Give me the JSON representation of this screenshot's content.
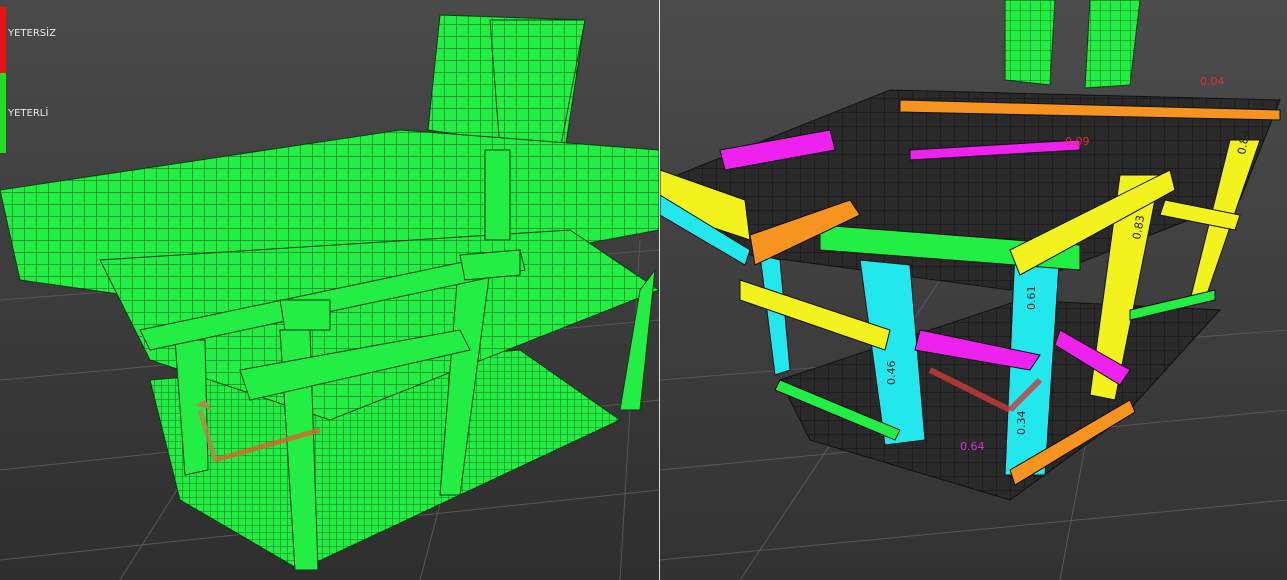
{
  "legend": {
    "items": [
      {
        "label": "YETERSİZ",
        "color": "#ee1111"
      },
      {
        "label": "YETERLİ",
        "color": "#22dd22"
      }
    ]
  },
  "colors": {
    "background": "#3a3a3a",
    "green_member": "#22ee44",
    "cyan_member": "#22e8ee",
    "magenta_member": "#ee22ee",
    "yellow_member": "#f2f21c",
    "orange_member": "#f79420",
    "slab_dark": "#2a2a2a",
    "gridline": "#111111",
    "axis_x": "#e0602a",
    "axis_y": "#b8864a"
  },
  "labels": {
    "ratio_labels": [
      "0.84",
      "0.83",
      "0.46",
      "0.34",
      "0.61",
      "0.04",
      "0.09",
      "0.64"
    ]
  }
}
